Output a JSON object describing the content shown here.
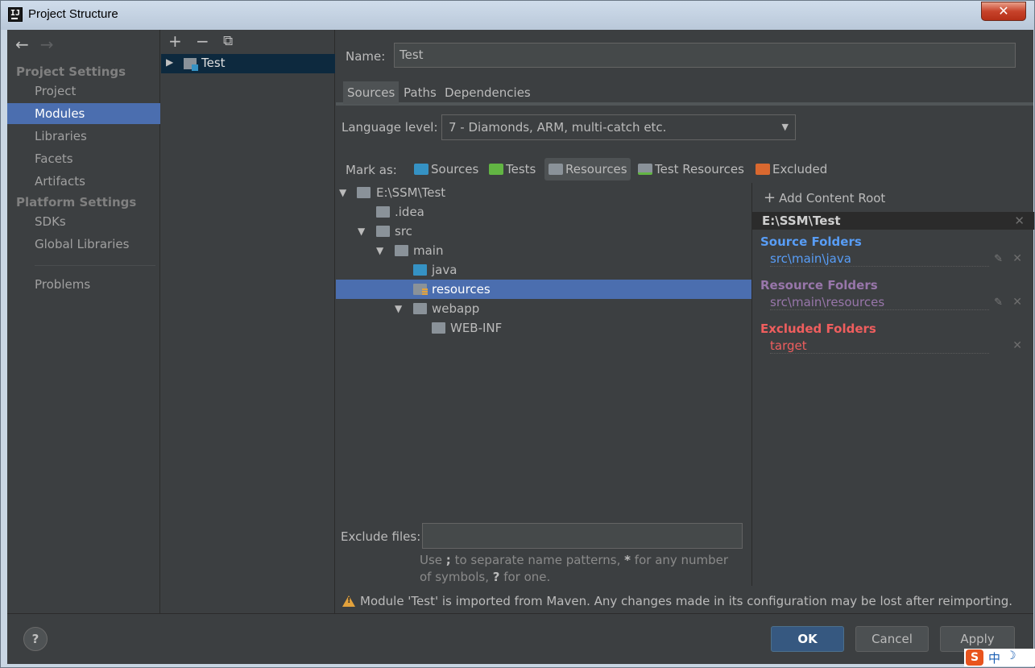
{
  "window": {
    "title": "Project Structure",
    "close_symbol": "✕"
  },
  "nav": {
    "back_symbol": "←",
    "forward_symbol": "→",
    "project_settings_title": "Project Settings",
    "project_settings_items": [
      "Project",
      "Modules",
      "Libraries",
      "Facets",
      "Artifacts"
    ],
    "platform_settings_title": "Platform Settings",
    "platform_settings_items": [
      "SDKs",
      "Global Libraries"
    ],
    "problems": "Problems",
    "selected": "Modules"
  },
  "modules": {
    "toolbar": {
      "add": "+",
      "remove": "−",
      "copy": "⧉"
    },
    "items": [
      {
        "name": "Test"
      }
    ]
  },
  "module": {
    "name_label": "Name:",
    "name_value": "Test",
    "tabs": [
      "Sources",
      "Paths",
      "Dependencies"
    ],
    "active_tab": "Sources",
    "language_level_label": "Language level:",
    "language_level_value": "7 - Diamonds, ARM, multi-catch etc.",
    "mark_as_label": "Mark as:",
    "mark_as_buttons": [
      {
        "label": "Sources",
        "color": "#3592c4"
      },
      {
        "label": "Tests",
        "color": "#62b543"
      },
      {
        "label": "Resources",
        "color": "#8a9299",
        "active": true
      },
      {
        "label": "Test Resources",
        "color": "#8a9299"
      },
      {
        "label": "Excluded",
        "color": "#d9682f"
      }
    ],
    "tree": [
      {
        "label": "E:\\SSM\\Test",
        "depth": 0,
        "expanded": true,
        "type": "folder"
      },
      {
        "label": ".idea",
        "depth": 1,
        "type": "folder"
      },
      {
        "label": "src",
        "depth": 1,
        "expanded": true,
        "type": "folder"
      },
      {
        "label": "main",
        "depth": 2,
        "expanded": true,
        "type": "folder"
      },
      {
        "label": "java",
        "depth": 3,
        "type": "source"
      },
      {
        "label": "resources",
        "depth": 3,
        "type": "resource",
        "selected": true
      },
      {
        "label": "webapp",
        "depth": 3,
        "expanded": true,
        "type": "folder"
      },
      {
        "label": "WEB-INF",
        "depth": 4,
        "type": "folder"
      }
    ],
    "content_root": {
      "add_label": "Add Content Root",
      "root_path": "E:\\SSM\\Test",
      "source_folders_title": "Source Folders",
      "source_folders": [
        "src\\main\\java"
      ],
      "resource_folders_title": "Resource Folders",
      "resource_folders": [
        "src\\main\\resources"
      ],
      "excluded_folders_title": "Excluded Folders",
      "excluded_folders": [
        "target"
      ],
      "colors": {
        "source": "#589df6",
        "resource": "#9876aa",
        "excluded": "#ef5e5e"
      }
    },
    "exclude_files_label": "Exclude files:",
    "exclude_files_value": "",
    "exclude_hint_pre": "Use ",
    "exclude_hint_semicolon": ";",
    "exclude_hint_mid": " to separate name patterns, ",
    "exclude_hint_star": "*",
    "exclude_hint_mid2": " for any number of symbols, ",
    "exclude_hint_q": "?",
    "exclude_hint_end": " for one.",
    "warning": "Module 'Test' is imported from Maven. Any changes made in its configuration may be lost after reimporting."
  },
  "footer": {
    "help": "?",
    "ok": "OK",
    "cancel": "Cancel",
    "apply": "Apply"
  },
  "ime": {
    "logo": "S",
    "lang": "中",
    "moon": "☽"
  }
}
